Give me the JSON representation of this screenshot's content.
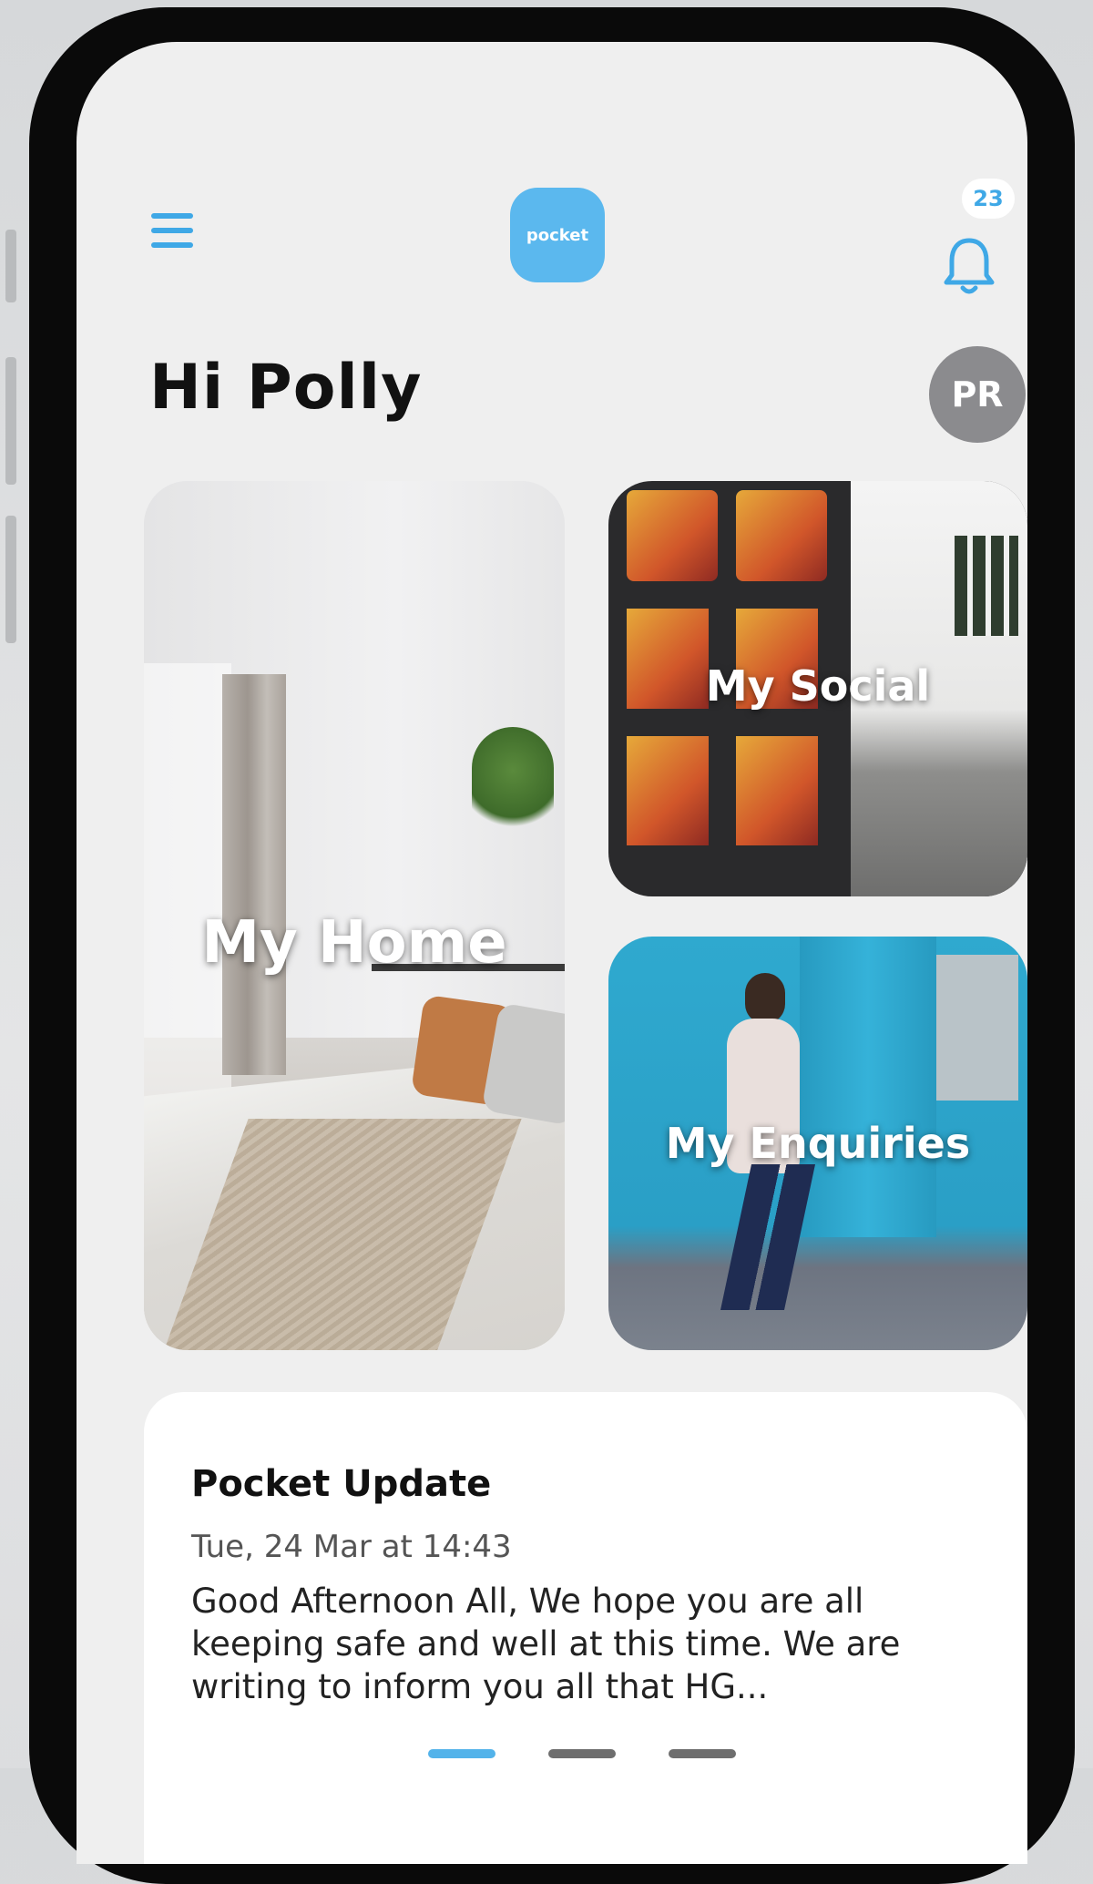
{
  "header": {
    "logo_text": "pocket",
    "notification_count": "23"
  },
  "greeting": "Hi Polly",
  "avatar_initials": "PR",
  "tiles": [
    {
      "label": "My Home"
    },
    {
      "label": "My Social"
    },
    {
      "label": "My Enquiries"
    }
  ],
  "update_card": {
    "title": "Pocket Update",
    "date": "Tue, 24 Mar at 14:43",
    "body": "Good Afternoon All, We hope you are all keeping safe and well at this time. We are writing to inform you all that HG...",
    "pagination": {
      "total": 3,
      "active_index": 0
    }
  },
  "colors": {
    "accent": "#3fa8e6",
    "logo_bg": "#5bb8ee",
    "avatar_bg": "#8b8b8e",
    "screen_bg": "#efefef"
  },
  "icons": {
    "menu": "hamburger-menu-icon",
    "notifications": "bell-icon"
  }
}
